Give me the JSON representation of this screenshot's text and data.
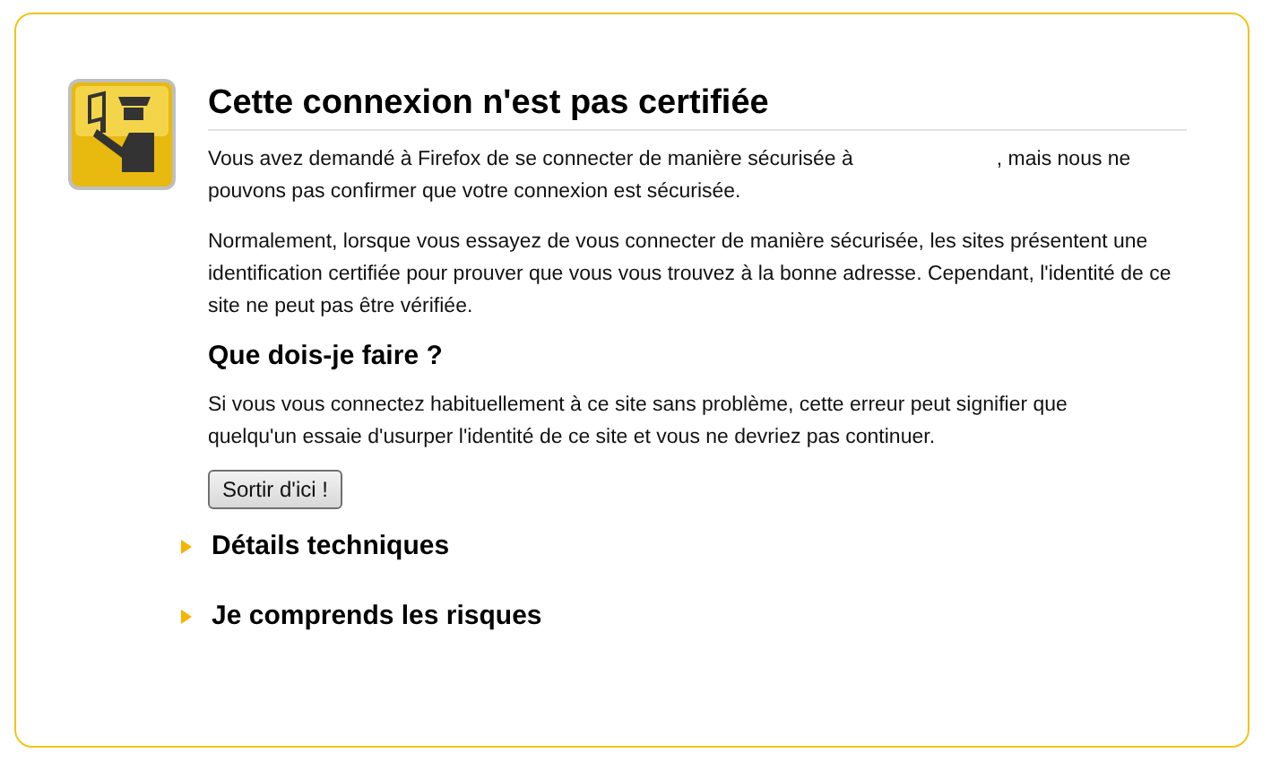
{
  "title": "Cette connexion n'est pas certifiée",
  "intro": {
    "before": "Vous avez demandé à Firefox de se connecter de manière sécurisée à",
    "after": ", mais nous ne pouvons pas confirmer que votre connexion est sécurisée."
  },
  "explanation": "Normalement, lorsque vous essayez de vous connecter de manière sécurisée, les sites présentent une identification certifiée pour prouver que vous vous trouvez à la bonne adresse. Cependant, l'identité de ce site ne peut pas être vérifiée.",
  "section_heading": "Que dois-je faire ?",
  "advice": "Si vous vous connectez habituellement à ce site sans problème, cette erreur peut signifier que quelqu'un essaie d'usurper l'identité de ce site et vous ne devriez pas continuer.",
  "button": "Sortir d'ici !",
  "expanders": [
    {
      "label": "Détails techniques",
      "expanded": false
    },
    {
      "label": "Je comprends les risques",
      "expanded": false
    }
  ]
}
